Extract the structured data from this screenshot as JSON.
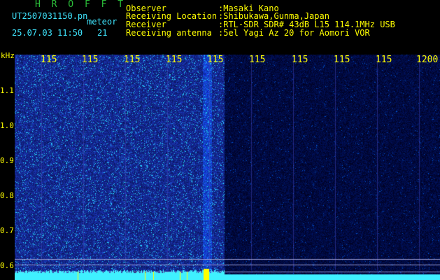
{
  "app": {
    "title": "H R O F F T"
  },
  "file": {
    "name": "UT2507031150.pn",
    "tag": "meteor",
    "datetime": "25.07.03 11:50",
    "count": "21"
  },
  "info": [
    {
      "label": "Observer",
      "value": ":Masaki Kano"
    },
    {
      "label": "Receiving Location",
      "value": ":Shibukawa,Gunma,Japan"
    },
    {
      "label": "Receiver",
      "value": ":RTL-SDR SDR# 43dB L15 114.1MHz USB"
    },
    {
      "label": "Receiving antenna",
      "value": ":5el Yagi Az 20 for Aomori VOR"
    }
  ],
  "y_axis": {
    "unit": "kHz",
    "ticks": [
      "1.1",
      "1.0",
      "0.9",
      "0.8",
      "0.7",
      "0.6"
    ]
  },
  "x_axis": {
    "ticks": [
      "115",
      "115",
      "115",
      "115",
      "115",
      "115",
      "115",
      "115",
      "115",
      "1200"
    ]
  },
  "colors": {
    "background": "#000000",
    "header_green": "#2bbf3a",
    "header_cyan": "#3fe6ff",
    "axis_yellow": "#ffff00",
    "spectrogram_blue": "#1a2aa8",
    "noise_floor_cyan": "#3ff0ff"
  }
}
